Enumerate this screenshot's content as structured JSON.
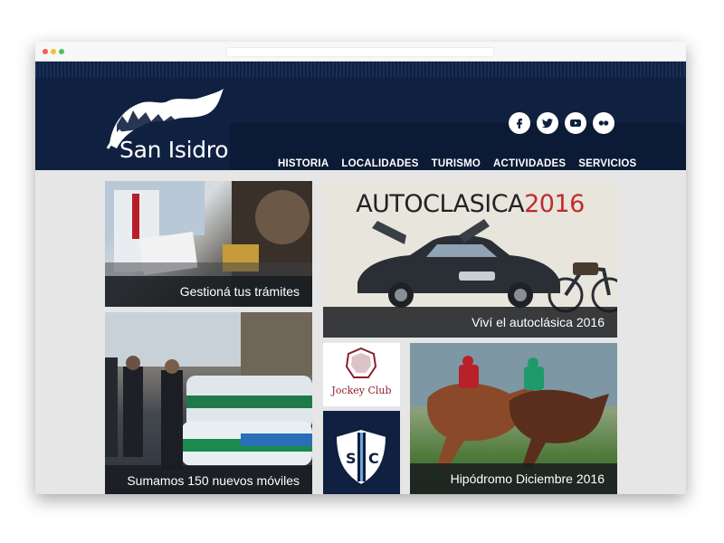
{
  "site": {
    "logo_text": "San Isidro"
  },
  "nav": [
    {
      "label": "HISTORIA"
    },
    {
      "label": "LOCALIDADES"
    },
    {
      "label": "TURISMO"
    },
    {
      "label": "ACTIVIDADES"
    },
    {
      "label": "SERVICIOS"
    }
  ],
  "social": [
    "facebook-icon",
    "twitter-icon",
    "youtube-icon",
    "flickr-icon"
  ],
  "tiles": {
    "tramites": {
      "caption": "Gestioná tus trámites"
    },
    "autoclasica": {
      "title_word": "AUTOCLASICA",
      "title_year": "2016",
      "caption": "Viví el autoclásica 2016"
    },
    "moviles": {
      "caption": "Sumamos 150 nuevos móviles"
    },
    "jockey": {
      "label": "Jockey Club"
    },
    "sic": {
      "letters": "SIC"
    },
    "hipodromo": {
      "caption": "Hipódromo Diciembre 2016"
    }
  },
  "colors": {
    "header": "#0f2040",
    "page_bg": "#e6e6e6",
    "autoclasica_year": "#c22a2a",
    "jockey_text": "#8a1f2a"
  }
}
